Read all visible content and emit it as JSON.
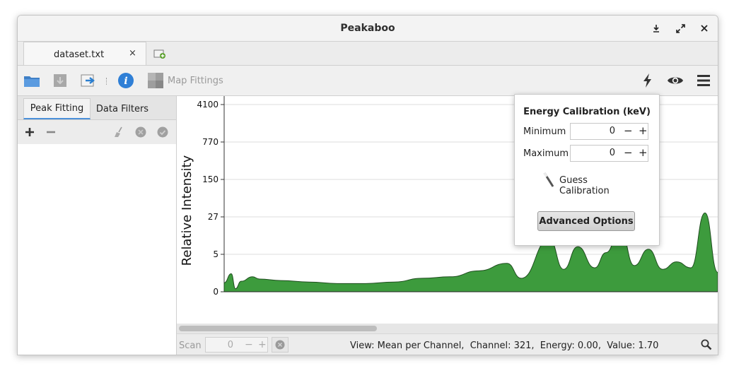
{
  "window": {
    "title": "Peakaboo",
    "controls": [
      "download-icon",
      "maximize-icon",
      "close-icon"
    ]
  },
  "tabs": {
    "documents": [
      {
        "label": "dataset.txt"
      }
    ],
    "close_glyph": "×"
  },
  "toolbar": {
    "map_fittings_label": "Map Fittings"
  },
  "sidebar": {
    "tabs": [
      {
        "label": "Peak Fitting",
        "active": true
      },
      {
        "label": "Data Filters",
        "active": false
      }
    ]
  },
  "status": {
    "scan_label": "Scan",
    "scan_value": "0",
    "minus": "−",
    "plus": "+",
    "info_text": "View: Mean per Channel,  Channel: 321,  Energy: 0.00,  Value: 1.70"
  },
  "calibration_popover": {
    "title": "Energy Calibration (keV)",
    "minimum_label": "Minimum",
    "minimum_value": "0",
    "maximum_label": "Maximum",
    "maximum_value": "0",
    "minus": "−",
    "plus": "+",
    "guess_label": "Guess Calibration",
    "advanced_label": "Advanced Options"
  },
  "chart_data": {
    "type": "area",
    "ylabel": "Relative Intensity",
    "xlabel": "",
    "y_scale": "log",
    "y_ticks": [
      "4100",
      "770",
      "150",
      "27",
      "5",
      "0"
    ],
    "x_start_channel": 0,
    "x_channels_visible": 349,
    "fill_color": "#3d9b3d",
    "stroke_color": "#1f4d1f",
    "grid": true,
    "peaks_note_level_baseline_units": "relative",
    "x": [
      0,
      5,
      8,
      12,
      20,
      25,
      40,
      60,
      80,
      100,
      120,
      140,
      160,
      180,
      200,
      210,
      230,
      240,
      250,
      262,
      270,
      280,
      290,
      300,
      310,
      320,
      330,
      340,
      349
    ],
    "y": [
      1.2,
      2.4,
      0.4,
      1.4,
      2.0,
      1.7,
      1.5,
      1.3,
      1.1,
      1.1,
      1.3,
      1.8,
      2.0,
      2.8,
      3.8,
      1.8,
      14,
      3.0,
      9.5,
      3.2,
      6.0,
      20,
      3.5,
      8.0,
      3.0,
      4.0,
      3.2,
      40,
      2.6
    ]
  }
}
